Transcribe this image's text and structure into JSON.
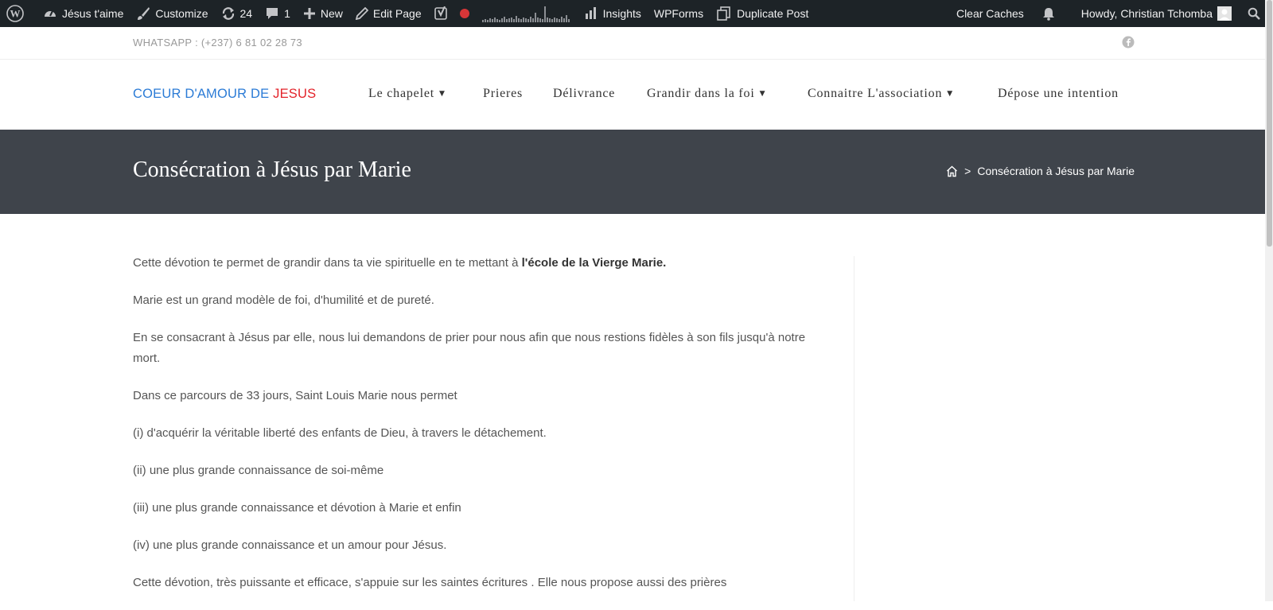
{
  "adminbar": {
    "site_name": "Jésus t'aime",
    "customize": "Customize",
    "updates_count": "24",
    "comments_count": "1",
    "new": "New",
    "edit_page": "Edit Page",
    "insights": "Insights",
    "wpforms": "WPForms",
    "duplicate_post": "Duplicate Post",
    "clear_caches": "Clear Caches",
    "howdy": "Howdy, Christian Tchomba"
  },
  "topbar": {
    "whatsapp": "WHATSAPP : (+237) 6 81 02 28 73"
  },
  "logo": {
    "part1": "COEUR D'AMOUR DE ",
    "part2": "JESUS",
    "color_blue": "#2b7bd6",
    "color_red": "#e3232a"
  },
  "nav": [
    {
      "label": "Le chapelet",
      "has_dropdown": true
    },
    {
      "label": "Prieres",
      "has_dropdown": false
    },
    {
      "label": "Délivrance",
      "has_dropdown": false
    },
    {
      "label": "Grandir dans la foi",
      "has_dropdown": true
    },
    {
      "label": "Connaitre L'association",
      "has_dropdown": true
    },
    {
      "label": "Dépose une intention",
      "has_dropdown": false
    }
  ],
  "page": {
    "title": "Consécration à Jésus par Marie",
    "breadcrumb_separator": ">",
    "breadcrumb_current": "Consécration à Jésus par Marie",
    "title_bar_color": "#3f444b"
  },
  "content": {
    "p1_text": "Cette dévotion te permet de grandir dans ta vie spirituelle en te mettant à ",
    "p1_bold": "l'école de la Vierge Marie.",
    "p2": "Marie est un grand modèle de foi, d'humilité et de pureté.",
    "p3": "En se consacrant à Jésus par elle, nous lui demandons de prier pour nous afin que nous restions fidèles à son fils jusqu'à notre mort.",
    "p4": "Dans ce parcours de 33 jours, Saint Louis Marie  nous permet",
    "p5": "(i) d'acquérir la véritable liberté des enfants de Dieu, à travers le détachement.",
    "p6": "(ii) une plus grande connaissance de soi-même",
    "p7": "(iii) une plus grande connaissance et dévotion à Marie et enfin",
    "p8": "(iv) une plus grande connaissance et un amour pour Jésus.",
    "p9": "Cette dévotion, très puissante et efficace, s'appuie sur les saintes écritures . Elle nous propose aussi des prières"
  },
  "icons": {
    "wp": "wordpress-logo-icon",
    "dashboard": "dashboard-icon",
    "brush": "brush-icon",
    "updates": "updates-icon",
    "comments": "comment-icon",
    "plus": "plus-icon",
    "pencil": "pencil-icon",
    "yoast": "yoast-icon",
    "insights": "bar-chart-icon",
    "duplicate": "duplicate-icon",
    "bell": "bell-icon",
    "avatar": "avatar-icon",
    "search": "search-icon",
    "facebook": "facebook-icon",
    "home": "home-icon"
  }
}
